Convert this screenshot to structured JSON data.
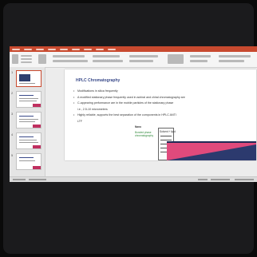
{
  "slide": {
    "title": "HPLC Chromatography",
    "bullets": [
      "Modifications in silica frequently",
      "A modified stationary phase frequently used in achiral and chiral chromatography are",
      "C-appearing performance are in the mobile particles of the stationary phase",
      "i.e., 2.5-10 micrometers",
      "Highly reliable, supports the best separation of the components in HPLC ANTI",
      "LTF"
    ],
    "diagram": {
      "top_label": "Nano",
      "left_label": "Bonded phase chromatography",
      "right_label": "Solvent + lipid"
    }
  },
  "thumbnails": [
    {
      "number": "1"
    },
    {
      "number": "2"
    },
    {
      "number": "3"
    },
    {
      "number": "4"
    },
    {
      "number": "5"
    }
  ],
  "colors": {
    "accent": "#c84a2f",
    "title": "#3a4a8a",
    "band_pink": "#e04a7c",
    "band_navy": "#2c3a6e"
  }
}
